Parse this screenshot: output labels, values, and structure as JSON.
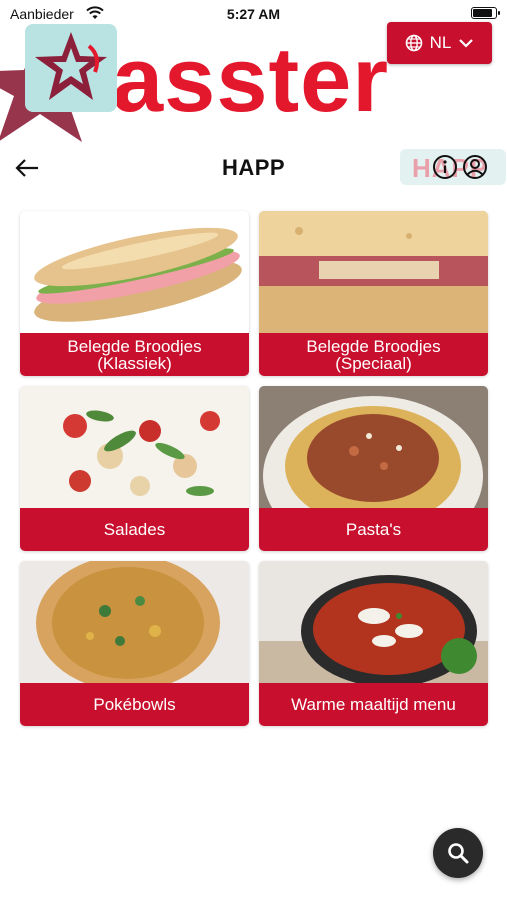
{
  "status_bar": {
    "carrier": "Aanbieder",
    "time": "5:27 AM",
    "battery_level": 0.9
  },
  "banner": {
    "brand_text": "asster",
    "language_label": "NL",
    "language_icon": "globe-icon",
    "chevron_icon": "chevron-down-icon",
    "colors": {
      "brand_red": "#e3182d",
      "logo_tile": "#b9e2e3",
      "star": "#8c1f3a"
    }
  },
  "header": {
    "title": "HAPP",
    "pill_text": "HAPP",
    "back_icon": "back-arrow-icon",
    "info_icon": "info-icon",
    "user_icon": "user-icon"
  },
  "categories": [
    {
      "label": "Belegde Broodjes (Klassiek)"
    },
    {
      "label": "Belegde Broodjes (Speciaal)"
    },
    {
      "label": "Salades"
    },
    {
      "label": "Pasta's"
    },
    {
      "label": "Pokébowls"
    },
    {
      "label": "Warme maaltijd menu"
    }
  ],
  "fab": {
    "icon": "search-icon"
  },
  "colors": {
    "accent": "#c8102e",
    "fab": "#2a2a2a"
  }
}
